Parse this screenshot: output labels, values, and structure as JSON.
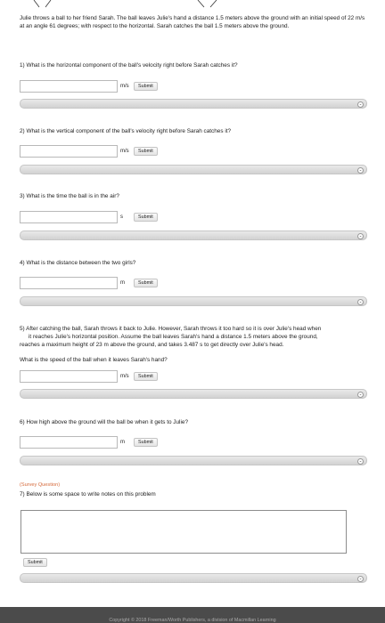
{
  "intro": "Julie throws a ball to her friend Sarah. The ball leaves Julie's hand a distance 1.5 meters above the ground with an initial speed of 22 m/s at an angle 61 degrees; with respect to the horizontal. Sarah catches the ball 1.5 meters above the ground.",
  "questions": [
    {
      "prompt": "1) What is the horizontal component of the ball's velocity right before Sarah catches it?",
      "unit": "m/s",
      "submit": "Submit",
      "value": ""
    },
    {
      "prompt": "2) What is the vertical component of the ball's velocity right before Sarah catches it?",
      "unit": "m/s",
      "submit": "Submit",
      "value": ""
    },
    {
      "prompt": "3) What is the time the ball is in the air?",
      "unit": "s",
      "submit": "Submit",
      "value": ""
    },
    {
      "prompt": "4) What is the distance between the two girls?",
      "unit": "m",
      "submit": "Submit",
      "value": ""
    },
    {
      "prompt": "What is the speed of the ball when it leaves Sarah's hand?",
      "unit": "m/s",
      "submit": "Submit",
      "value": ""
    },
    {
      "prompt": "6) How high above the ground will the ball be when it gets to Julie?",
      "unit": "m",
      "submit": "Submit",
      "value": ""
    }
  ],
  "q5_part1": "5) After catching the ball, Sarah throws it back to Julie. However, Sarah throws it too hard so it is over Julie's head when",
  "q5_part2": "it reaches Julie's horizontal position. Assume the ball leaves Sarah's hand a distance 1.5 meters above the ground,",
  "q5_part3": "reaches a maximum height of 23 m above the ground, and takes 3.487 s to get directly over Julie's head.",
  "survey": {
    "tag": "(Survey Question)",
    "prompt": "7) Below is some space to write notes on this problem",
    "submit": "Submit",
    "notes_value": ""
  },
  "expander_icon": "chevron-down-icon",
  "footer": "Copyright © 2018 Freeman/Worth Publishers, a division of Macmillan Learning"
}
